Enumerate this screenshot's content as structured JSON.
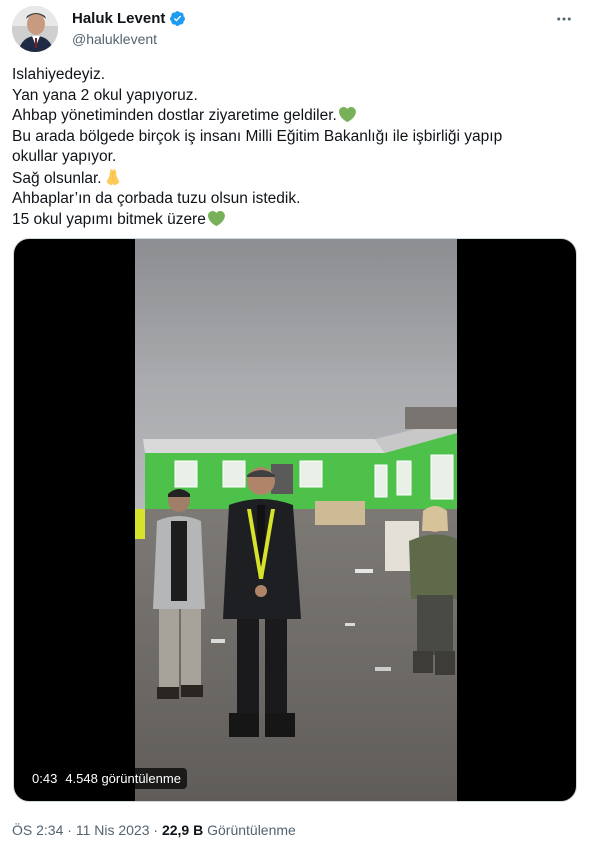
{
  "author": {
    "display_name": "Haluk Levent",
    "handle": "@haluklevent",
    "verified": true
  },
  "more_icon": "more-horizontal-icon",
  "tweet": {
    "lines": [
      "Islahiyedeyiz.",
      "Yan yana 2 okul yapıyoruz.",
      "Ahbap yönetiminden dostlar ziyaretime geldiler.",
      "Bu arada bölgede birçok iş insanı Milli Eğitim Bakanlığı ile işbirliği yapıp",
      "okullar yapıyor.",
      "Sağ olsunlar.",
      "Ahbaplar’ın da çorbada tuzu olsun istedik.",
      "15 okul yapımı bitmek üzere"
    ],
    "emoji": {
      "heart": "green-heart-emoji",
      "pray": "folded-hands-emoji"
    }
  },
  "video": {
    "duration": "0:43",
    "views": "4.548 görüntülenme"
  },
  "meta": {
    "time": "ÖS 2:34",
    "separator": "·",
    "date": "11 Nis 2023",
    "views_count": "22,9 B",
    "views_label": "Görüntülenme"
  },
  "colors": {
    "text": "#0f1419",
    "secondary": "#536471",
    "verified": "#1d9bf0",
    "heart": "#78b159",
    "building_green": "#4ec14a"
  }
}
